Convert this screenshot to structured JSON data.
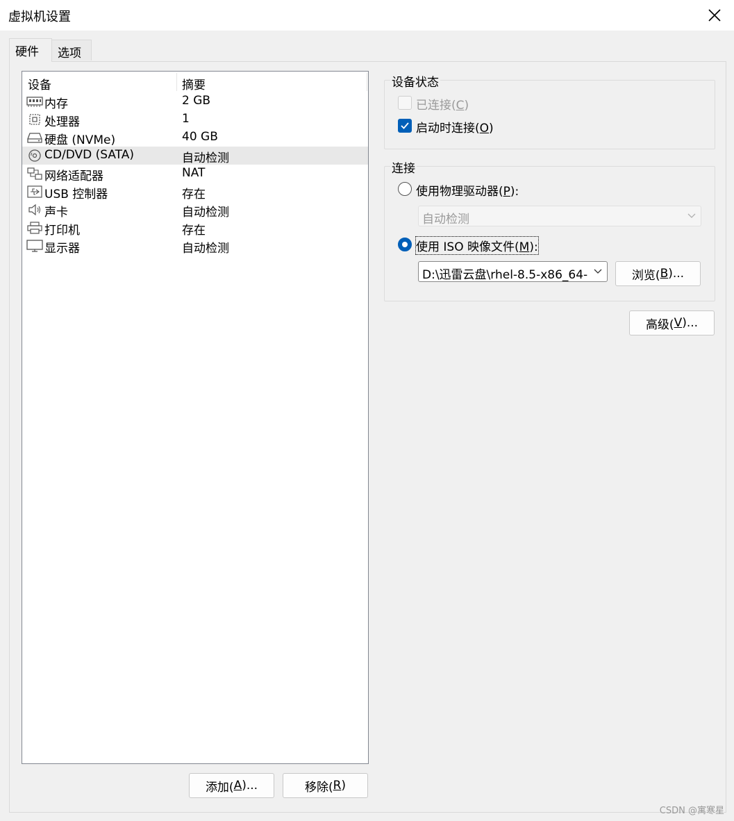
{
  "window": {
    "title": "虚拟机设置"
  },
  "tabs": [
    {
      "label": "硬件",
      "active": true
    },
    {
      "label": "选项",
      "active": false
    }
  ],
  "device_list": {
    "columns": [
      "设备",
      "摘要"
    ],
    "rows": [
      {
        "icon": "memory-icon",
        "name": "内存",
        "summary": "2 GB"
      },
      {
        "icon": "processor-icon",
        "name": "处理器",
        "summary": "1"
      },
      {
        "icon": "hard-disk-icon",
        "name": "硬盘 (NVMe)",
        "summary": "40 GB"
      },
      {
        "icon": "cd-dvd-icon",
        "name": "CD/DVD (SATA)",
        "summary": "自动检测",
        "selected": true
      },
      {
        "icon": "network-adapter-icon",
        "name": "网络适配器",
        "summary": "NAT"
      },
      {
        "icon": "usb-icon",
        "name": "USB 控制器",
        "summary": "存在"
      },
      {
        "icon": "sound-card-icon",
        "name": "声卡",
        "summary": "自动检测"
      },
      {
        "icon": "printer-icon",
        "name": "打印机",
        "summary": "存在"
      },
      {
        "icon": "display-icon",
        "name": "显示器",
        "summary": "自动检测"
      }
    ]
  },
  "buttons": {
    "add": {
      "text": "添加(",
      "key": "A",
      "suffix": ")..."
    },
    "remove": {
      "text": "移除(",
      "key": "R",
      "suffix": ")"
    },
    "browse": {
      "text": "浏览(",
      "key": "B",
      "suffix": ")..."
    },
    "advanced": {
      "text": "高级(",
      "key": "V",
      "suffix": ")..."
    }
  },
  "device_status": {
    "title": "设备状态",
    "connected": {
      "text": "已连接(",
      "key": "C",
      "suffix": ")",
      "checked": false,
      "enabled": false
    },
    "connect_at_power_on": {
      "text": "启动时连接(",
      "key": "O",
      "suffix": ")",
      "checked": true,
      "enabled": true
    }
  },
  "connection": {
    "title": "连接",
    "physical_drive": {
      "text": "使用物理驱动器(",
      "key": "P",
      "suffix": "):",
      "selected": false
    },
    "physical_drive_value": "自动检测",
    "iso_image": {
      "text": "使用 ISO 映像文件(",
      "key": "M",
      "suffix": "):",
      "selected": true
    },
    "iso_path": "D:\\迅雷云盘\\rhel-8.5-x86_64-"
  },
  "watermark": "CSDN @寓寒星"
}
